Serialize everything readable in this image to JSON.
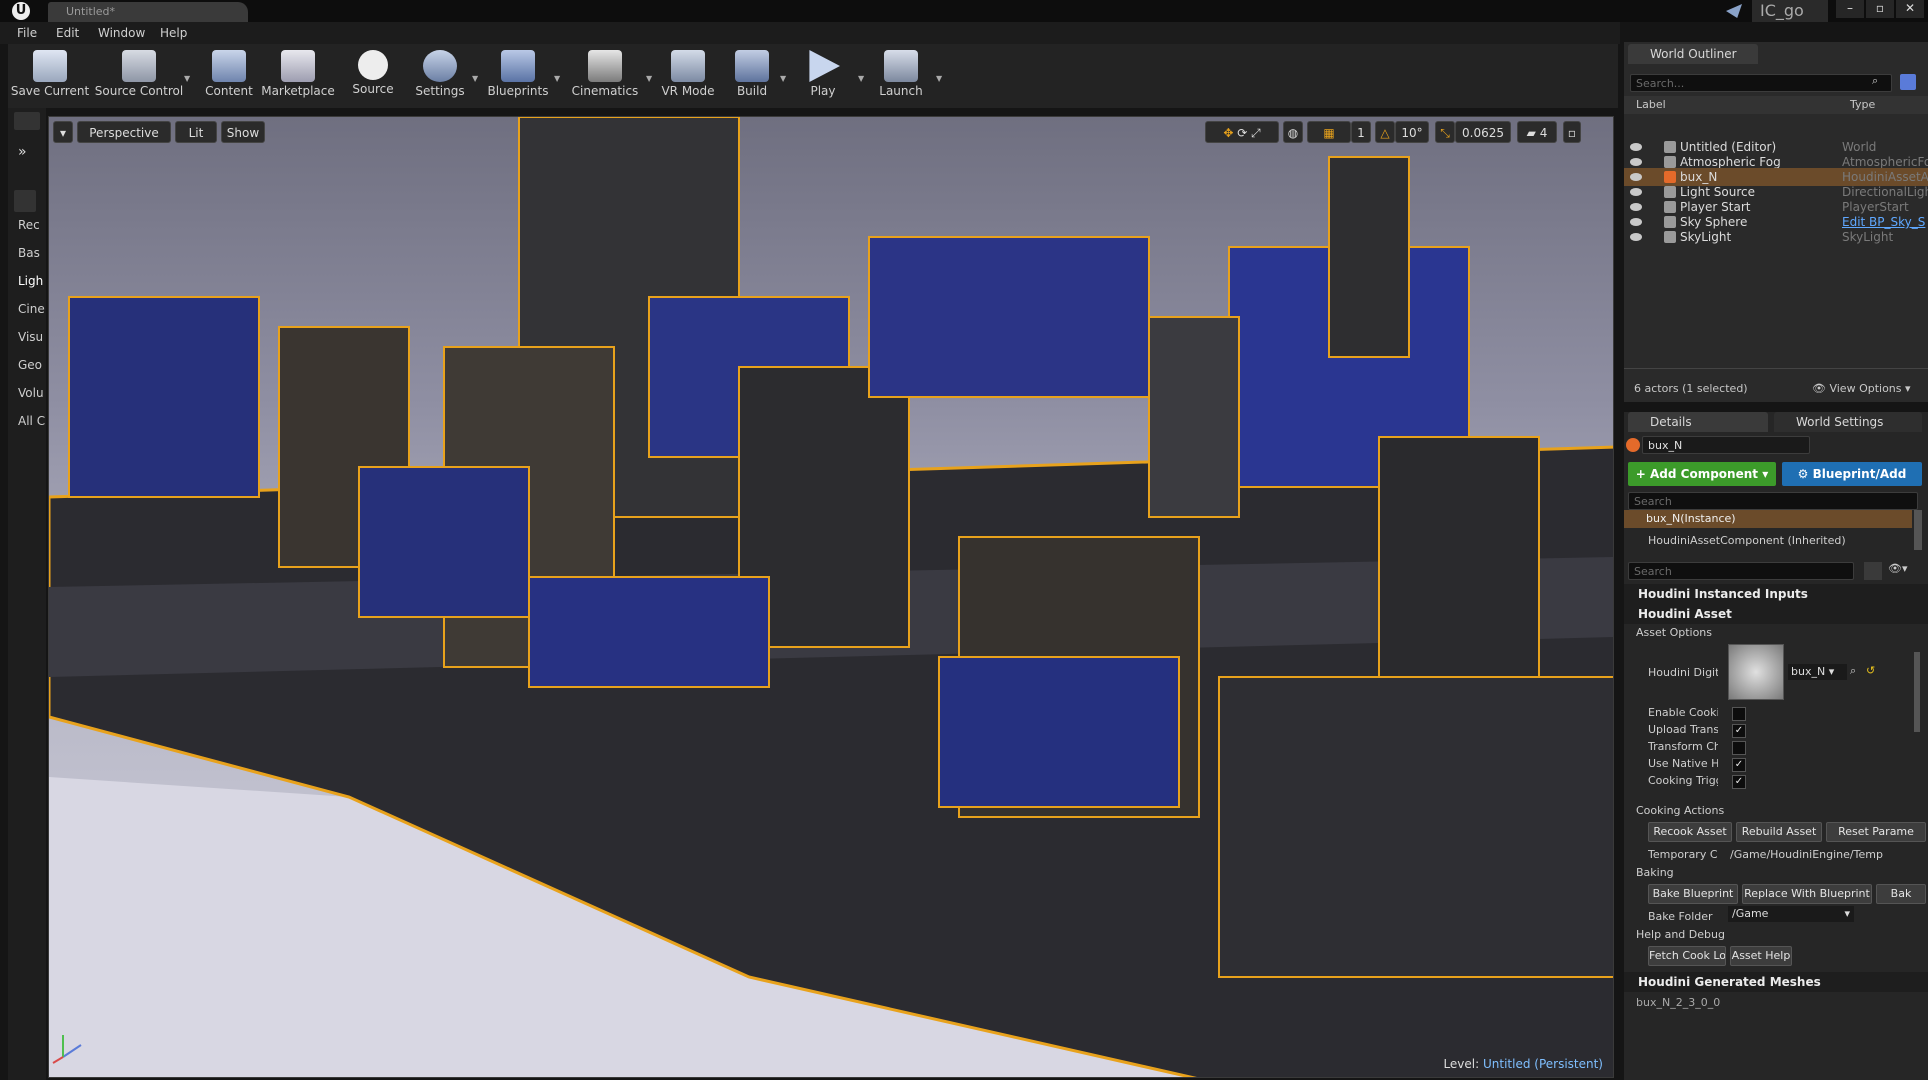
{
  "titlebar": {
    "document_tab": "Untitled*",
    "project_name": "IC_go"
  },
  "menu": [
    "File",
    "Edit",
    "Window",
    "Help"
  ],
  "toolbar": [
    {
      "label": "Save Current",
      "icon": "save-icon",
      "caret": false
    },
    {
      "label": "Source Control",
      "icon": "source-control-icon",
      "caret": true
    },
    {
      "label": "Content",
      "icon": "content-icon",
      "caret": false
    },
    {
      "label": "Marketplace",
      "icon": "marketplace-icon",
      "caret": false
    },
    {
      "label": "Source",
      "icon": "source-icon",
      "caret": false
    },
    {
      "label": "Settings",
      "icon": "settings-icon",
      "caret": true
    },
    {
      "label": "Blueprints",
      "icon": "blueprints-icon",
      "caret": true
    },
    {
      "label": "Cinematics",
      "icon": "cinematics-icon",
      "caret": true
    },
    {
      "label": "VR Mode",
      "icon": "vr-mode-icon",
      "caret": false
    },
    {
      "label": "Build",
      "icon": "build-icon",
      "caret": true
    },
    {
      "label": "Play",
      "icon": "play-icon",
      "caret": true
    },
    {
      "label": "Launch",
      "icon": "launch-icon",
      "caret": true
    }
  ],
  "place_modes": [
    "Rec",
    "Bas",
    "Ligh",
    "Cine",
    "Visu",
    "Geo",
    "Volu",
    "All C"
  ],
  "viewport": {
    "perspective": "Perspective",
    "lit": "Lit",
    "show": "Show",
    "grid_snap": "1",
    "rotation_snap": "10°",
    "scale_snap": "0.0625",
    "camera_speed": "4",
    "level_label": "Level:",
    "level_name": "Untitled (Persistent)"
  },
  "outliner": {
    "tab": "World Outliner",
    "search_placeholder": "Search...",
    "col_label": "Label",
    "col_type": "Type",
    "rows": [
      {
        "label": "Untitled (Editor)",
        "type": "World",
        "selected": false
      },
      {
        "label": "Atmospheric Fog",
        "type": "AtmosphericFo",
        "selected": false
      },
      {
        "label": "bux_N",
        "type": "HoudiniAssetA",
        "selected": true
      },
      {
        "label": "Light Source",
        "type": "DirectionalLigh",
        "selected": false
      },
      {
        "label": "Player Start",
        "type": "PlayerStart",
        "selected": false
      },
      {
        "label": "Sky Sphere",
        "type": "Edit BP_Sky_S",
        "selected": false
      },
      {
        "label": "SkyLight",
        "type": "SkyLight",
        "selected": false
      }
    ],
    "actor_count": "6 actors (1 selected)",
    "view_options": "View Options"
  },
  "details": {
    "tab_details": "Details",
    "tab_world_settings": "World Settings",
    "actor_name": "bux_N",
    "add_component": "+ Add Component",
    "blueprint_add": "Blueprint/Add",
    "search_placeholder": "Search",
    "instance_row": "bux_N(Instance)",
    "component_row": "HoudiniAssetComponent (Inherited)",
    "search2_placeholder": "Search",
    "section_instanced_inputs": "Houdini Instanced Inputs",
    "section_asset": "Houdini Asset",
    "asset_options": "Asset Options",
    "houdini_digital_label": "Houdini Digita",
    "asset_combo": "bux_N",
    "props": [
      {
        "label": "Enable Cookin",
        "checked": false
      },
      {
        "label": "Upload Transf",
        "checked": true
      },
      {
        "label": "Transform Ch",
        "checked": false
      },
      {
        "label": "Use Native Ho",
        "checked": true
      },
      {
        "label": "Cooking Trigg",
        "checked": true
      }
    ],
    "cooking_actions": "Cooking Actions",
    "recook": "Recook Asset",
    "rebuild": "Rebuild Asset",
    "reset_params": "Reset Parame",
    "temp_label": "Temporary Co",
    "temp_value": "/Game/HoudiniEngine/Temp",
    "baking": "Baking",
    "bake_blueprint": "Bake Blueprint",
    "replace_blueprint": "Replace With Blueprint",
    "bake_more": "Bak",
    "bake_folder_label": "Bake Folder",
    "bake_folder_value": "/Game",
    "help_debug": "Help and Debug",
    "fetch_log": "Fetch Cook Log",
    "asset_help": "Asset Help",
    "section_generated": "Houdini Generated Meshes",
    "generated_first": "bux_N_2_3_0_0"
  },
  "colors": {
    "accent": "#e8a21c",
    "selected_row": "#6b4b2a",
    "add_component": "#3c9b2a",
    "blueprint_add": "#1f6fb3"
  }
}
